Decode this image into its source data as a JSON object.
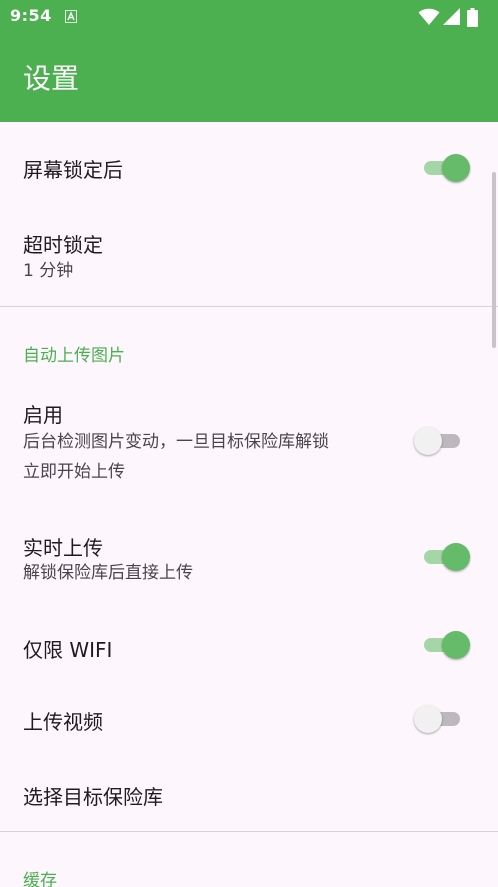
{
  "status_bar": {
    "time": "9:54",
    "icons": [
      "a-notification-icon",
      "wifi-icon",
      "cellular-signal-icon",
      "battery-icon"
    ]
  },
  "app_bar": {
    "title": "设置"
  },
  "settings": {
    "lock_after_screen_lock": {
      "title": "屏幕锁定后",
      "enabled": true
    },
    "timeout_lock": {
      "title": "超时锁定",
      "summary": "1 分钟"
    },
    "auto_upload_category": {
      "title": "自动上传图片"
    },
    "enable_auto_upload": {
      "title": "启用",
      "summary_line1": "后台检测图片变动，一旦目标保险库解锁",
      "summary_line2": "立即开始上传",
      "enabled": false
    },
    "realtime_upload": {
      "title": "实时上传",
      "summary": "解锁保险库后直接上传",
      "enabled": true
    },
    "wifi_only": {
      "title": "仅限 WIFI",
      "enabled": true
    },
    "upload_videos": {
      "title": "上传视频",
      "enabled": false
    },
    "select_target_vault": {
      "title": "选择目标保险库"
    },
    "cache_category": {
      "title": "缓存"
    }
  },
  "colors": {
    "accent": "#4caf50",
    "switch_on_thumb": "#66bb6a",
    "switch_on_track": "#a5d6a7",
    "switch_off_thumb": "#f1f1f1",
    "switch_off_track": "#bdb8bd",
    "background": "#fdf7fd"
  }
}
